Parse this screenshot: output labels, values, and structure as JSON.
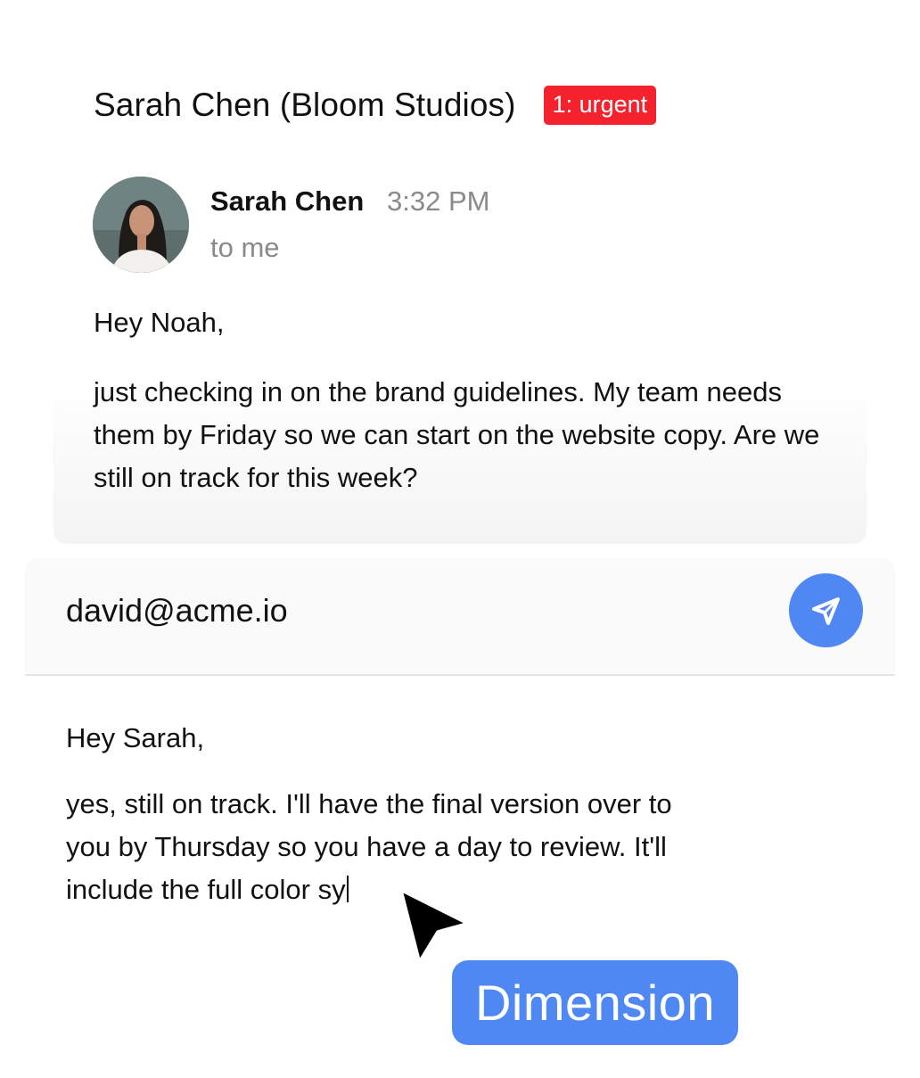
{
  "thread": {
    "subject": "Sarah Chen (Bloom Studios)",
    "badge": "1: urgent"
  },
  "message": {
    "sender_name": "Sarah Chen",
    "time": "3:32 PM",
    "recipient": "to me",
    "greeting": "Hey Noah,",
    "body": "just checking in on the brand guidelines. My team needs them by Friday so we can start on the website copy. Are we still on track for this week?"
  },
  "reply": {
    "to_address": "david@acme.io",
    "greeting": "Hey Sarah,",
    "body_line1": "yes, still on track. I'll have the final version over to",
    "body_line2": "you by Thursday so you have a day to review. It'll",
    "body_line3": "include the full color sy"
  },
  "overlay": {
    "label": "Dimension"
  },
  "icons": {
    "send": "send-icon",
    "cursor": "mouse-pointer-icon",
    "avatar": "avatar"
  },
  "colors": {
    "badge": "#f4222d",
    "accent": "#4f88f2",
    "muted_text": "#8a8a8a"
  }
}
